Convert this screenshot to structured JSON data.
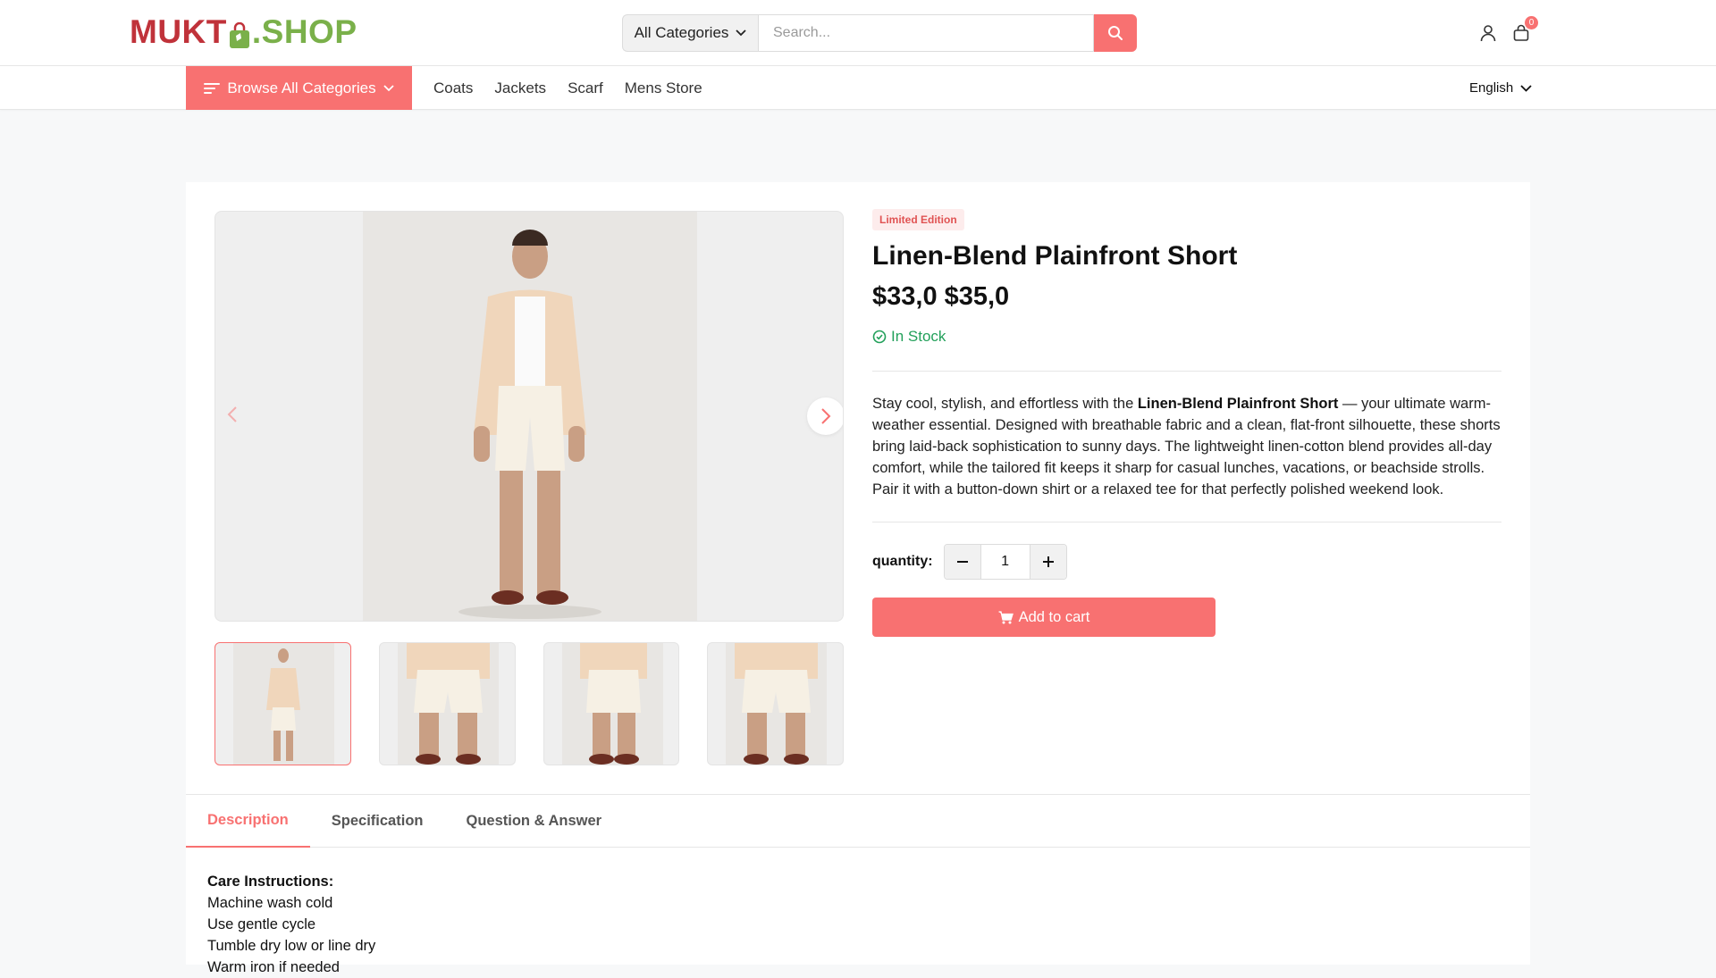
{
  "brand": {
    "logo_left": "MUKT",
    "logo_right": ".SHOP",
    "colors": {
      "red": "#c0323a",
      "green": "#7ab04a",
      "accent": "#f87171"
    }
  },
  "header": {
    "category_select": "All Categories",
    "search_placeholder": "Search...",
    "cart_count": "0"
  },
  "nav": {
    "browse_label": "Browse All Categories",
    "links": [
      "Coats",
      "Jackets",
      "Scarf",
      "Mens Store"
    ],
    "language": "English"
  },
  "product": {
    "badge": "Limited Edition",
    "title": "Linen-Blend Plainfront Short",
    "price": "$33,0",
    "old_price": "$35,0",
    "stock": "In Stock",
    "desc_before": "Stay cool, stylish, and effortless with the ",
    "desc_bold": "Linen-Blend Plainfront Short",
    "desc_after": " — your ultimate warm-weather essential. Designed with breathable fabric and a clean, flat-front silhouette, these shorts bring laid-back sophistication to sunny days. The lightweight linen-cotton blend provides all-day comfort, while the tailored fit keeps it sharp for casual lunches, vacations, or beachside strolls. Pair it with a button-down shirt or a relaxed tee for that perfectly polished weekend look.",
    "quantity_label": "quantity:",
    "quantity": "1",
    "add_to_cart": "Add to cart"
  },
  "tabs": [
    "Description",
    "Specification",
    "Question & Answer"
  ],
  "care": {
    "title": "Care Instructions:",
    "lines": [
      "Machine wash cold",
      "Use gentle cycle",
      "Tumble dry low or line dry",
      "Warm iron if needed"
    ]
  }
}
